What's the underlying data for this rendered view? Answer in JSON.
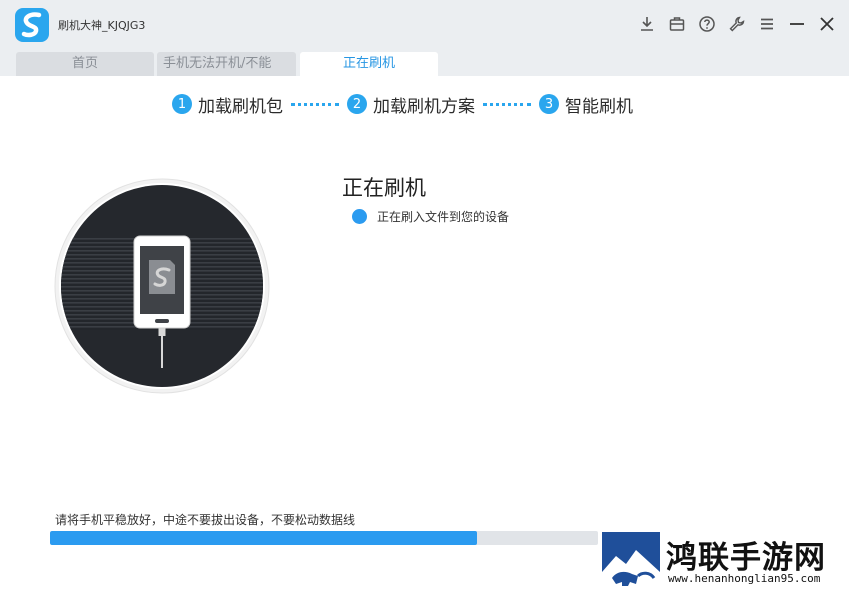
{
  "app": {
    "title": "刷机大神_KJQJG3",
    "logo_icon": "app-logo-icon",
    "accent": "#2aa6ee"
  },
  "window_controls": [
    {
      "name": "download-icon"
    },
    {
      "name": "toolbox-icon"
    },
    {
      "name": "help-icon"
    },
    {
      "name": "wrench-icon"
    },
    {
      "name": "menu-icon"
    },
    {
      "name": "minimize-icon"
    },
    {
      "name": "close-icon"
    }
  ],
  "tabs": [
    {
      "label": "首页",
      "active": false
    },
    {
      "label": "手机无法开机/不能",
      "active": false
    },
    {
      "label": "正在刷机",
      "active": true
    }
  ],
  "steps": [
    {
      "num": "1",
      "label": "加载刷机包"
    },
    {
      "num": "2",
      "label": "加载刷机方案"
    },
    {
      "num": "3",
      "label": "智能刷机"
    }
  ],
  "status": {
    "title": "正在刷机",
    "item": "正在刷入文件到您的设备",
    "dot_color": "#2b9bf0"
  },
  "progress": {
    "tip": "请将手机平稳放好，中途不要拔出设备，不要松动数据线",
    "fraction": 0.78,
    "color": "#2b9bf0"
  },
  "watermark": {
    "title": "鸿联手游网",
    "url": "www.henanhonglian95.com"
  }
}
